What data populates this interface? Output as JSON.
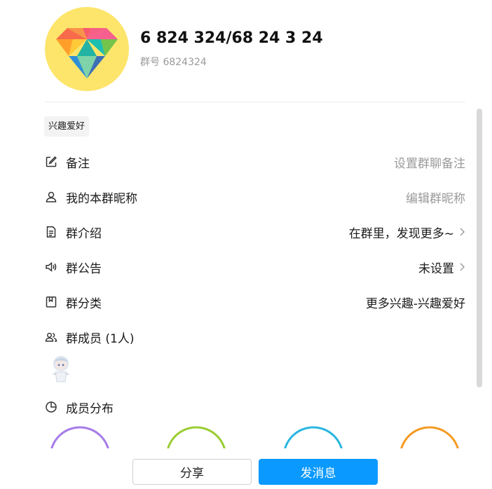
{
  "group": {
    "name": "6 824 324/68 24 3 24",
    "id_text": "群号 6824324"
  },
  "tag": "兴趣爱好",
  "rows": {
    "remark": {
      "label": "备注",
      "value": "设置群聊备注"
    },
    "nickname": {
      "label": "我的本群昵称",
      "value": "编辑群昵称"
    },
    "intro": {
      "label": "群介绍",
      "value": "在群里，发现更多~"
    },
    "notice": {
      "label": "群公告",
      "value": "未设置"
    },
    "category": {
      "label": "群分类",
      "value": "更多兴趣-兴趣爱好"
    },
    "members": {
      "label": "群成员 (1人)"
    },
    "distribution": {
      "label": "成员分布"
    }
  },
  "distribution_colors": [
    "#a67be8",
    "#9acd32",
    "#29b6e0",
    "#f59a23"
  ],
  "footer": {
    "share": "分享",
    "send": "发消息"
  },
  "colors": {
    "accent": "#0a99ff",
    "avatar_bg": "#fde56b",
    "muted_text": "#9a9a9a"
  }
}
